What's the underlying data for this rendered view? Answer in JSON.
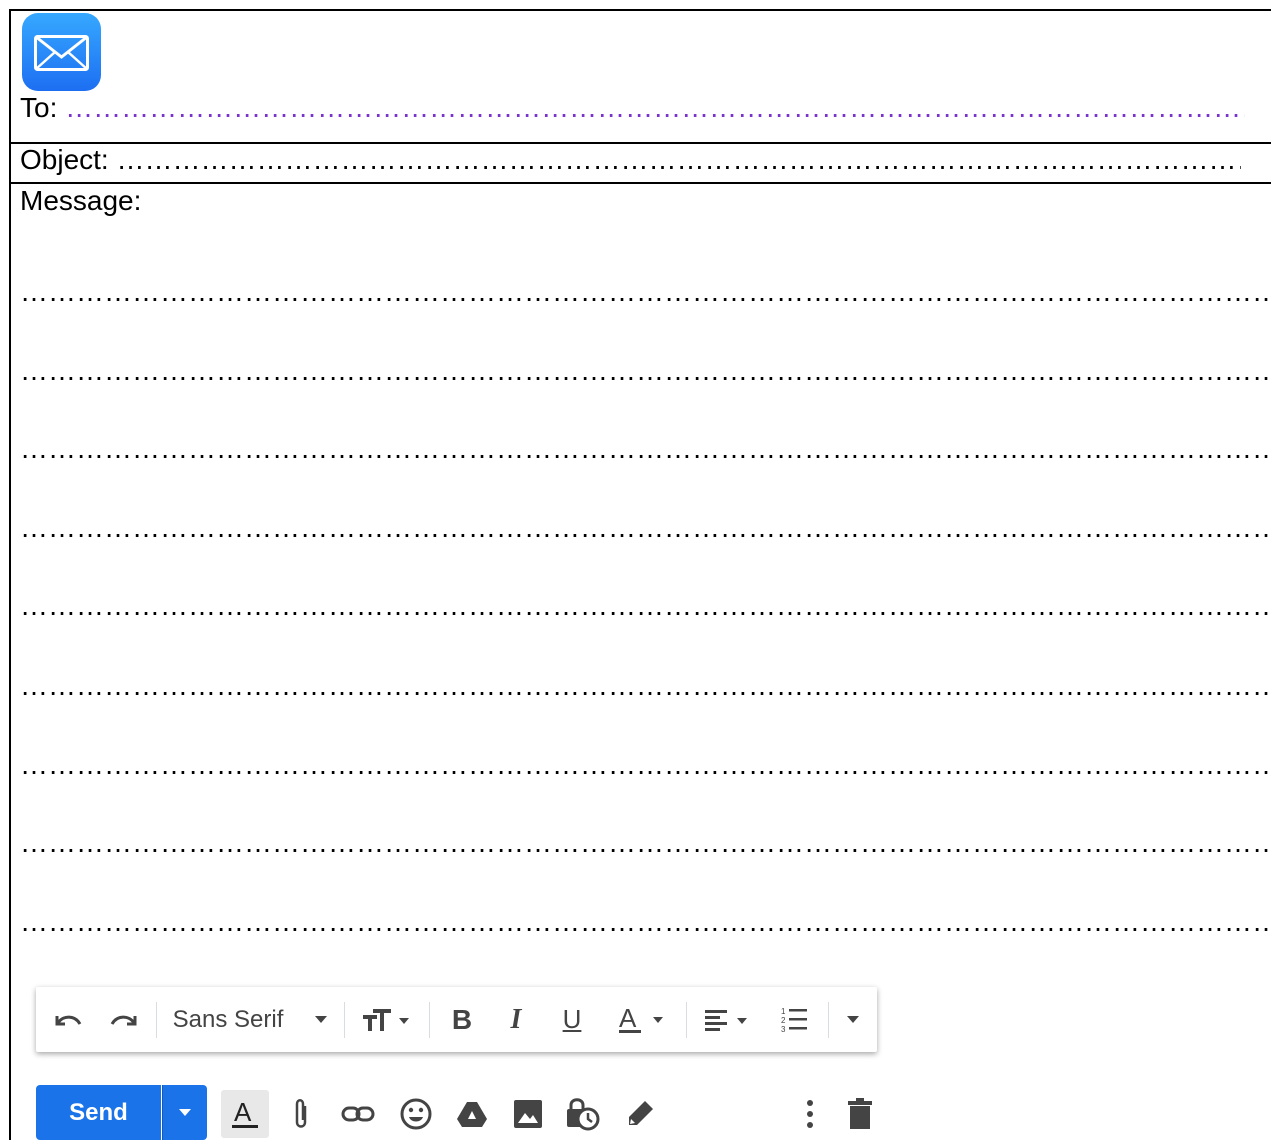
{
  "header": {
    "to_label": "To: ",
    "to_dots": "………………………………………………………………………………………………………………………………………………………………",
    "object_label": "Object: ",
    "object_dots": "………………………………………………………………………………………………………………………………………………………………"
  },
  "message": {
    "label": "Message:",
    "lines": [
      "…………………………………………………………………………………………………………………………………………………………………………",
      "…………………………………………………………………………………………………………………………………………………………………………",
      "…………………………………………………………………………………………………………………………………………………………………………",
      "…………………………………………………………………………………………………………………………………………………………………………",
      "…………………………………………………………………………………………………………………………………………………………………………",
      "…………………………………………………………………………………………………………………………………………………………………………",
      "…………………………………………………………………………………………………………………………………………………………………………",
      "…………………………………………………………………………………………………………………………………………………………………………",
      "…………………………………………………………………………………………………………………………………………………………………………"
    ]
  },
  "toolbar": {
    "font_name": "Sans Serif",
    "icons": [
      "undo-icon",
      "redo-icon",
      "font-dropdown",
      "text-size-icon",
      "bold-icon",
      "italic-icon",
      "underline-icon",
      "text-color-icon",
      "align-icon",
      "numbered-list-icon",
      "more-formatting-icon"
    ]
  },
  "bottom_bar": {
    "send_label": "Send",
    "icons": [
      "formatting-options-icon",
      "attach-icon",
      "link-icon",
      "emoji-icon",
      "drive-icon",
      "photo-icon",
      "confidential-icon",
      "signature-icon",
      "more-options-icon",
      "trash-icon"
    ]
  },
  "colors": {
    "send_button": "#1a73e8",
    "to_dots": "#7a33cc",
    "mail_icon": "#1d6ff2"
  }
}
